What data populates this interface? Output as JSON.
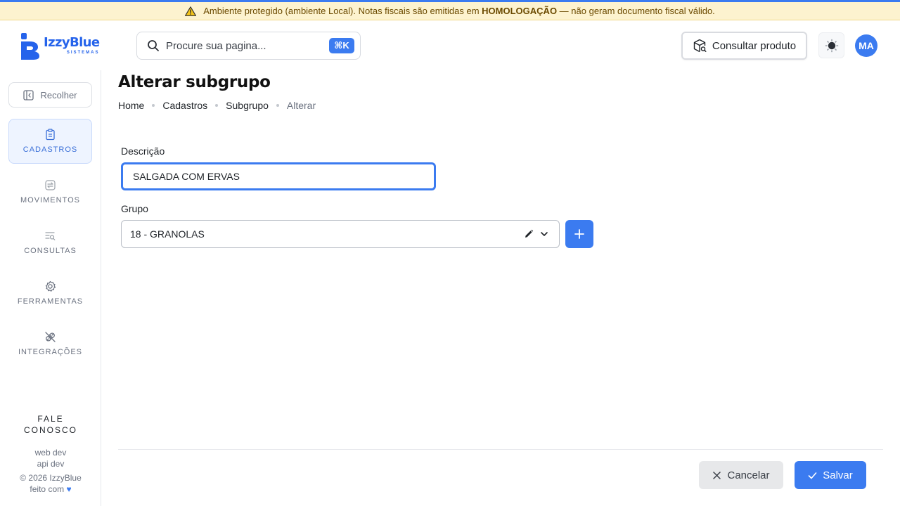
{
  "banner": {
    "text_before": "Ambiente protegido (ambiente Local). Notas fiscais são emitidas em ",
    "text_bold": "HOMOLOGAÇÃO",
    "text_after": " — não geram documento fiscal válido."
  },
  "header": {
    "logo_name": "IzzyBlue",
    "logo_sub": "SISTEMAS",
    "search_placeholder": "Procure sua pagina...",
    "search_shortcut": "⌘K",
    "consult_button": "Consultar produto",
    "avatar_initials": "MA"
  },
  "sidebar": {
    "collapse_label": "Recolher",
    "items": [
      {
        "label": "CADASTROS",
        "icon": "clipboard-icon",
        "active": true
      },
      {
        "label": "MOVIMENTOS",
        "icon": "arrows-exchange-icon",
        "active": false
      },
      {
        "label": "CONSULTAS",
        "icon": "list-search-icon",
        "active": false
      },
      {
        "label": "FERRAMENTAS",
        "icon": "gear-icon",
        "active": false
      },
      {
        "label": "INTEGRAÇÕES",
        "icon": "plug-icon",
        "active": false
      }
    ],
    "footer": {
      "contact_line1": "FALE",
      "contact_line2": "CONOSCO",
      "web_dev": "web dev",
      "api_dev": "api dev",
      "copyright": "© 2026 IzzyBlue",
      "made_with": "feito com"
    }
  },
  "page": {
    "title": "Alterar subgrupo",
    "breadcrumb": [
      "Home",
      "Cadastros",
      "Subgrupo",
      "Alterar"
    ]
  },
  "form": {
    "descricao_label": "Descrição",
    "descricao_value": "SALGADA COM ERVAS",
    "grupo_label": "Grupo",
    "grupo_value": "18 - GRANOLAS"
  },
  "actions": {
    "cancel": "Cancelar",
    "save": "Salvar"
  },
  "colors": {
    "accent": "#3b7bf0",
    "banner_bg": "#fdf3cf",
    "banner_text": "#6b4a00"
  }
}
